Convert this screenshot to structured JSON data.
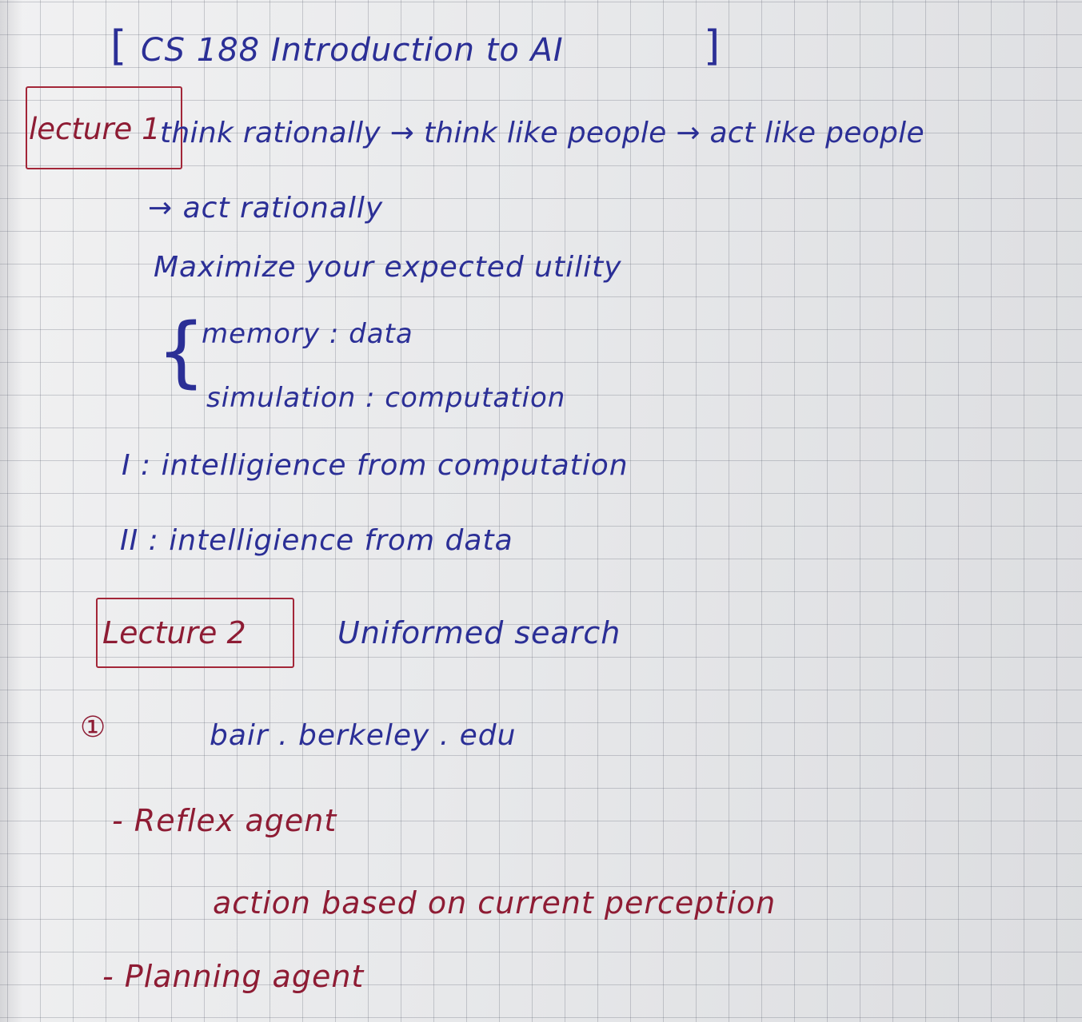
{
  "heading": {
    "open_bracket": "[",
    "title": "CS 188   Introduction   to   AI",
    "close_bracket": "]"
  },
  "lecture1": {
    "label": "lecture 1",
    "line1": "think  rationally  →  think  like  people  →  act  like  people",
    "line2": "→  act  rationally",
    "line3": "Maximize  your  expected  utility",
    "brace": "{",
    "memory": "memory :  data",
    "simulation": "simulation :  computation",
    "point1": "I :  intelligience  from  computation",
    "point2": "II :  intelligience  from  data"
  },
  "lecture2": {
    "label": "Lecture 2",
    "topic": "Uniformed  search",
    "item_marker": "①",
    "item_text": "bair . berkeley . edu",
    "reflex_heading": "-  Reflex  agent",
    "reflex_detail": "action  based  on  current  perception",
    "planning_heading": "-  Planning  agent"
  },
  "colors": {
    "blue_ink": "#2b2f96",
    "red_ink": "#8e1c34",
    "box_ink": "#a32638",
    "paper": "#e9eaec",
    "grid": "#5a5f6e"
  }
}
